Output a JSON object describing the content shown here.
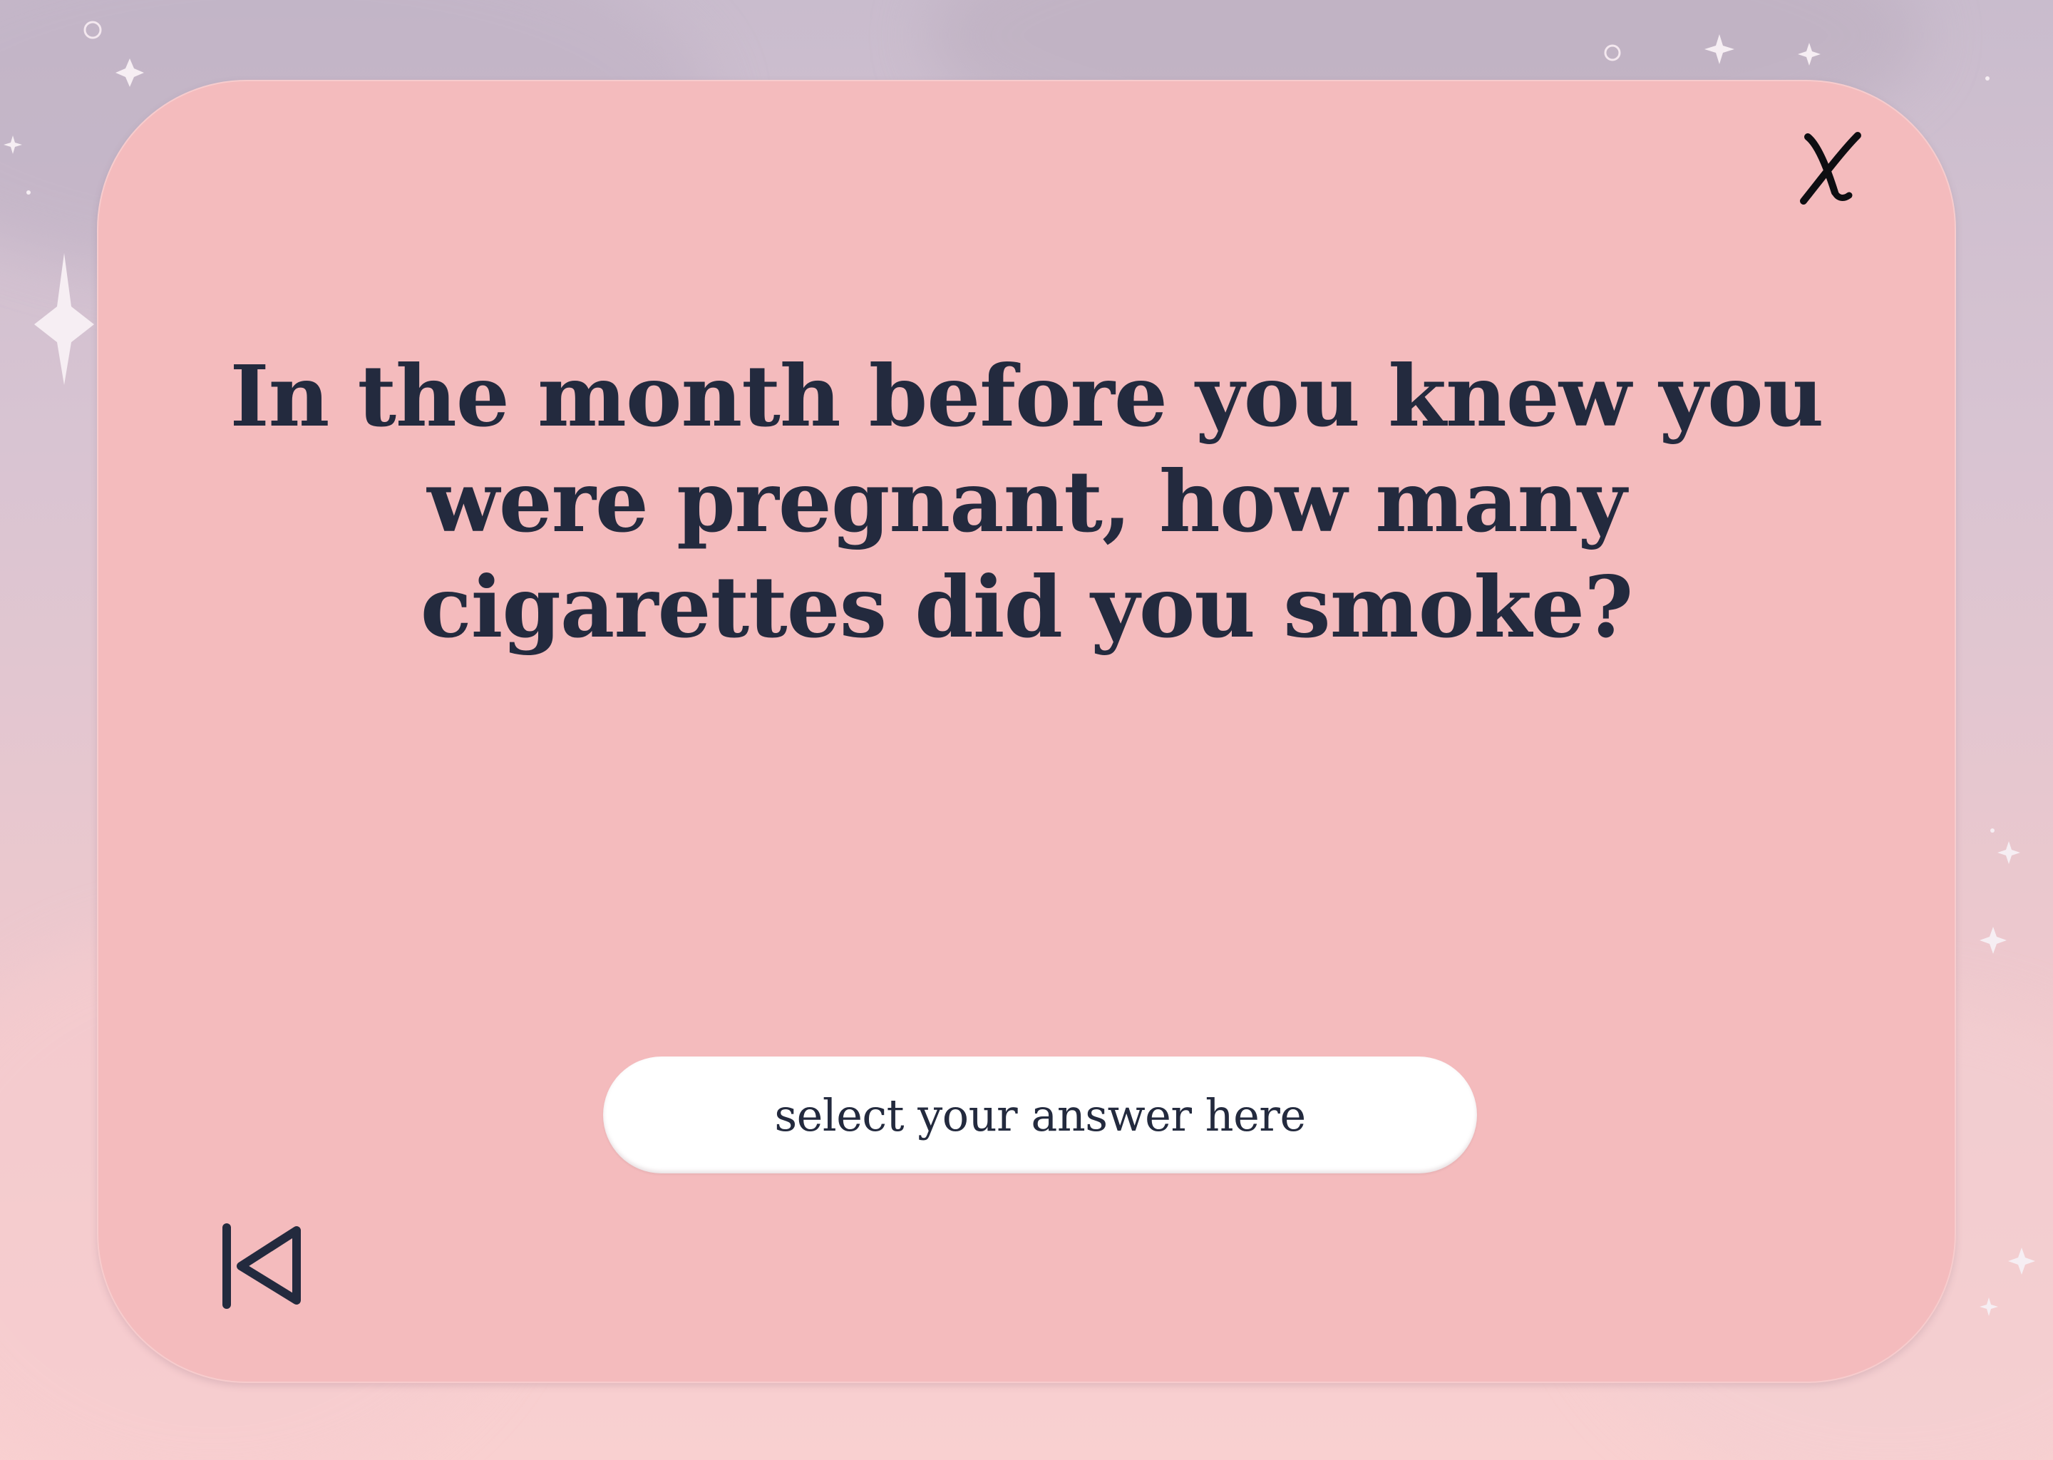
{
  "question": {
    "text": "In the month before you knew you were pregnant, how many cigarettes did you smoke?"
  },
  "answer_select": {
    "placeholder": "select your answer here"
  },
  "icons": {
    "close": "close-icon",
    "back": "skip-back-icon"
  },
  "colors": {
    "card_background": "#f4bbbd",
    "text": "#232a3e",
    "select_background": "#ffffff",
    "page_background_top": "#c9bccd",
    "page_background_bottom": "#f9d0d0"
  }
}
